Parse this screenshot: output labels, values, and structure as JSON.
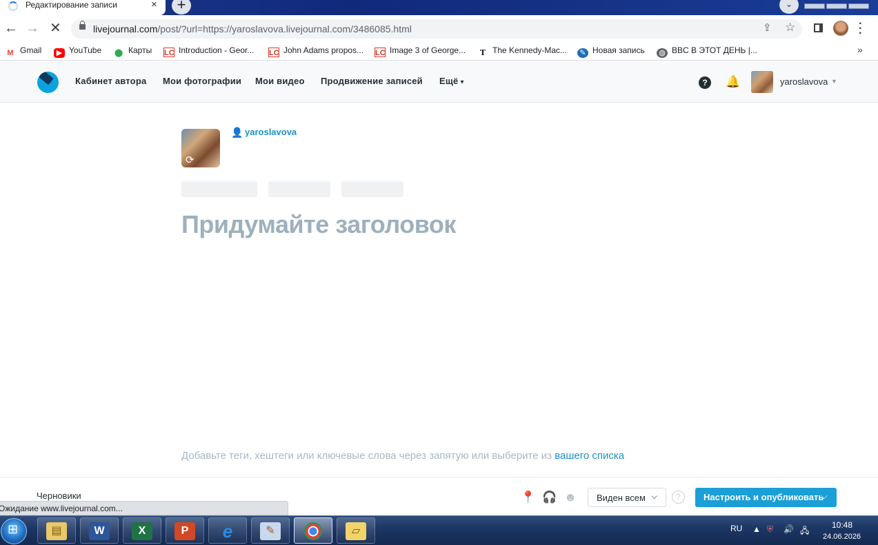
{
  "browser": {
    "tab_title": "Редактирование записи",
    "tab_close": "×",
    "new_tab": "+",
    "url_host": "livejournal.com",
    "url_rest": "/post/?url=https://yaroslavova.livejournal.com/3486085.html",
    "bookmarks": [
      {
        "label": "Gmail",
        "icon": "gmail-icon",
        "glyph": "M"
      },
      {
        "label": "YouTube",
        "icon": "youtube-icon",
        "glyph": "▶"
      },
      {
        "label": "Карты",
        "icon": "maps-icon",
        "glyph": "⬤"
      },
      {
        "label": "Introduction - Geor...",
        "icon": "loc-icon",
        "glyph": "LC"
      },
      {
        "label": "John Adams propos...",
        "icon": "loc-icon",
        "glyph": "LC"
      },
      {
        "label": "Image 3 of George...",
        "icon": "loc-icon",
        "glyph": "LC"
      },
      {
        "label": "The Kennedy-Mac...",
        "icon": "nyt-icon",
        "glyph": "T"
      },
      {
        "label": "Новая запись",
        "icon": "livejournal-icon",
        "glyph": "✎"
      },
      {
        "label": "BBC В ЭТОТ ДЕНЬ |...",
        "icon": "globe-icon",
        "glyph": "◍"
      }
    ],
    "bookmarks_more": "»"
  },
  "lj_header": {
    "nav": [
      "Кабинет автора",
      "Мои фотографии",
      "Мои видео",
      "Продвижение записей",
      "Ещё"
    ],
    "help": "?",
    "username": "yaroslavova"
  },
  "editor": {
    "author": "yaroslavova",
    "title_placeholder": "Придумайте заголовок",
    "tags_hint": "Добавьте теги, хештеги или ключевые слова через запятую или выберите из ",
    "tags_link": "вашего списка"
  },
  "bottom_bar": {
    "drafts": "Черновики",
    "visibility": "Виден всем",
    "help": "?",
    "publish": "Настроить и опубликовать"
  },
  "status_bubble": "Ожидание www.livejournal.com...",
  "taskbar": {
    "apps": [
      {
        "name": "explorer",
        "glyph": "🗂"
      },
      {
        "name": "word",
        "glyph": "W"
      },
      {
        "name": "excel",
        "glyph": "X"
      },
      {
        "name": "powerpoint",
        "glyph": "P"
      },
      {
        "name": "internet-explorer",
        "glyph": "e"
      },
      {
        "name": "paint",
        "glyph": "🎨"
      },
      {
        "name": "chrome",
        "glyph": "◉"
      },
      {
        "name": "folder",
        "glyph": "▱"
      }
    ],
    "lang": "RU",
    "time": "10:48",
    "date": "24.06.2026"
  },
  "colors": {
    "lj_blue": "#1a9fd7",
    "link": "#1a92c8",
    "placeholder": "#9eb0bd"
  }
}
